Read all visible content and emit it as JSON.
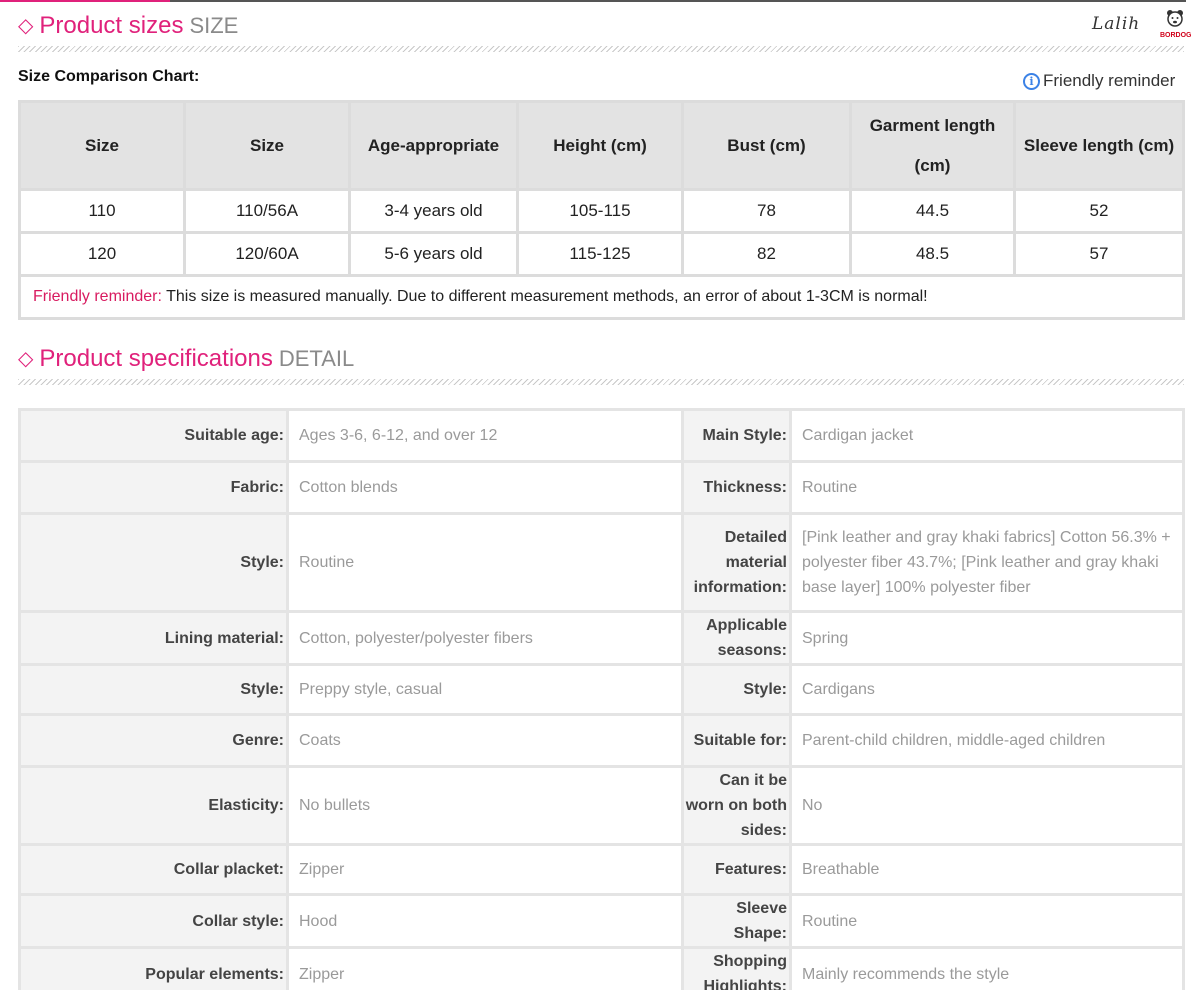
{
  "sizes_section": {
    "title": "Product sizes",
    "subtitle": "SIZE"
  },
  "logo": {
    "script": "Lalih",
    "brand": "BORDOG"
  },
  "size_chart": {
    "label": "Size Comparison Chart:",
    "reminder_link": "Friendly reminder",
    "headers": [
      "Size",
      "Size",
      "Age-appropriate",
      "Height (cm)",
      "Bust (cm)",
      "Garment length",
      "(cm)",
      "Sleeve length (cm)"
    ],
    "rows": [
      [
        "110",
        "110/56A",
        "3-4 years old",
        "105-115",
        "78",
        "44.5",
        "52"
      ],
      [
        "120",
        "120/60A",
        "5-6 years old",
        "115-125",
        "82",
        "48.5",
        "57"
      ]
    ],
    "note_label": "Friendly reminder:",
    "note_text": " This size is measured manually. Due to different measurement methods, an error of about 1-3CM is normal!"
  },
  "spec_section": {
    "title": "Product specifications",
    "subtitle": "DETAIL"
  },
  "specs": [
    {
      "k1": "Suitable age:",
      "v1": "Ages 3-6, 6-12, and over 12",
      "k2": "Main Style:",
      "v2": "Cardigan jacket"
    },
    {
      "k1": "Fabric:",
      "v1": "Cotton blends",
      "k2": "Thickness:",
      "v2": "Routine"
    },
    {
      "k1": "Style:",
      "v1": "Routine",
      "k2": "Detailed material information:",
      "v2": "[Pink leather and gray khaki fabrics] Cotton 56.3% + polyester fiber 43.7%; [Pink leather and gray khaki base layer] 100% polyester fiber"
    },
    {
      "k1": "Lining material:",
      "v1": "Cotton, polyester/polyester fibers",
      "k2": "Applicable seasons:",
      "v2": "Spring"
    },
    {
      "k1": "Style:",
      "v1": "Preppy style, casual",
      "k2": "Style:",
      "v2": "Cardigans"
    },
    {
      "k1": "Genre:",
      "v1": "Coats",
      "k2": "Suitable for:",
      "v2": "Parent-child children, middle-aged children"
    },
    {
      "k1": "Elasticity:",
      "v1": "No bullets",
      "k2": "Can it be worn on both sides:",
      "v2": "No"
    },
    {
      "k1": "Collar placket:",
      "v1": "Zipper",
      "k2": "Features:",
      "v2": "Breathable"
    },
    {
      "k1": "Collar style:",
      "v1": "Hood",
      "k2": "Sleeve Shape:",
      "v2": "Routine"
    },
    {
      "k1": "Popular elements:",
      "v1": "Zipper",
      "k2": "Shopping Highlights:",
      "v2": "Mainly recommends the style"
    }
  ]
}
